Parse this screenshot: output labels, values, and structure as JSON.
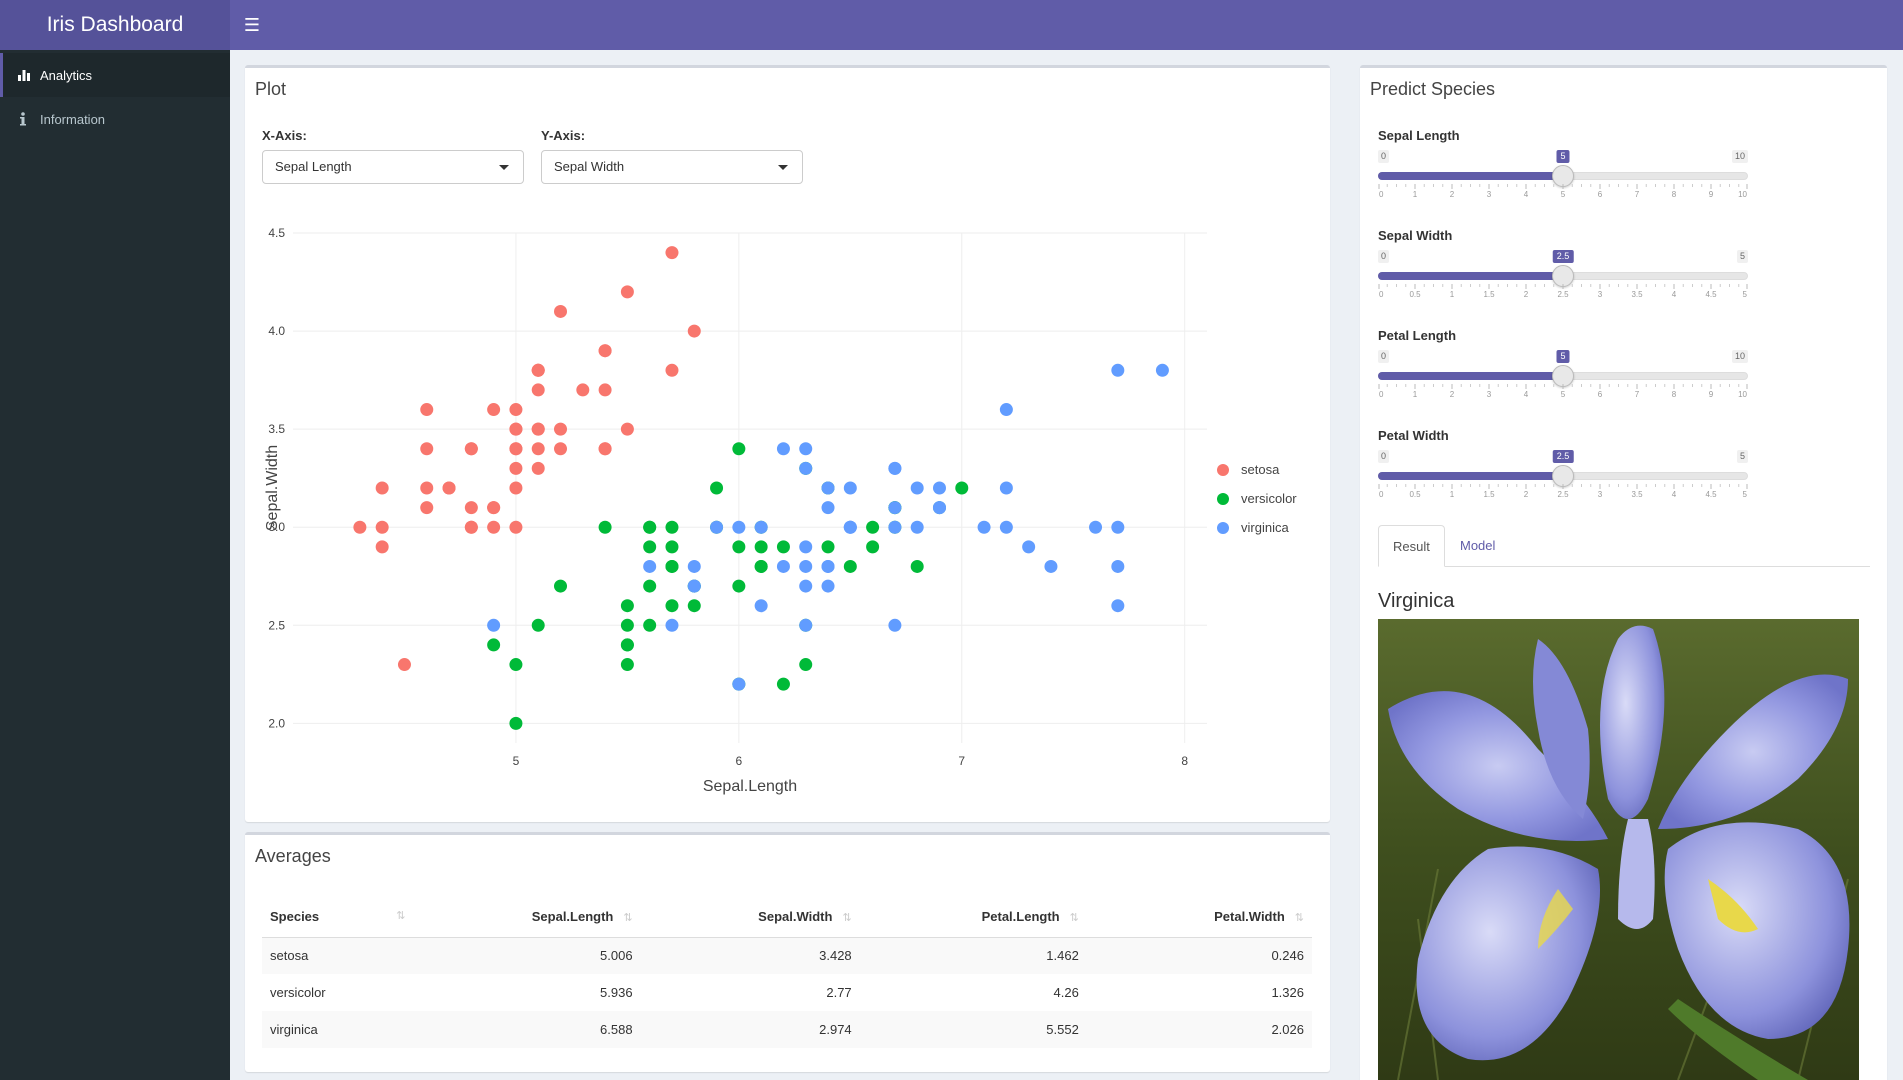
{
  "app": {
    "title": "Iris Dashboard"
  },
  "sidebar": {
    "items": [
      {
        "label": "Analytics",
        "icon": "bar-chart-icon"
      },
      {
        "label": "Information",
        "icon": "info-icon"
      }
    ]
  },
  "plot_box": {
    "title": "Plot",
    "x_axis": {
      "label": "X-Axis:",
      "value": "Sepal Length"
    },
    "y_axis": {
      "label": "Y-Axis:",
      "value": "Sepal Width"
    }
  },
  "chart_data": {
    "type": "scatter",
    "xlabel": "Sepal.Length",
    "ylabel": "Sepal.Width",
    "xlim": [
      4.0,
      8.1
    ],
    "ylim": [
      1.9,
      4.5
    ],
    "x_ticks": [
      "5",
      "6",
      "7",
      "8"
    ],
    "y_ticks": [
      "2.0",
      "2.5",
      "3.0",
      "3.5",
      "4.0",
      "4.5"
    ],
    "legend": "right",
    "series": [
      {
        "name": "setosa",
        "color": "#f8766d",
        "points": [
          [
            5.1,
            3.5
          ],
          [
            4.9,
            3.0
          ],
          [
            4.7,
            3.2
          ],
          [
            4.6,
            3.1
          ],
          [
            5.0,
            3.6
          ],
          [
            5.4,
            3.9
          ],
          [
            4.6,
            3.4
          ],
          [
            5.0,
            3.4
          ],
          [
            4.4,
            2.9
          ],
          [
            4.9,
            3.1
          ],
          [
            5.4,
            3.7
          ],
          [
            4.8,
            3.4
          ],
          [
            4.8,
            3.0
          ],
          [
            4.3,
            3.0
          ],
          [
            5.8,
            4.0
          ],
          [
            5.7,
            4.4
          ],
          [
            5.4,
            3.9
          ],
          [
            5.1,
            3.5
          ],
          [
            5.7,
            3.8
          ],
          [
            5.1,
            3.8
          ],
          [
            5.4,
            3.4
          ],
          [
            5.1,
            3.7
          ],
          [
            4.6,
            3.6
          ],
          [
            5.1,
            3.3
          ],
          [
            4.8,
            3.4
          ],
          [
            5.0,
            3.0
          ],
          [
            5.0,
            3.4
          ],
          [
            5.2,
            3.5
          ],
          [
            5.2,
            3.4
          ],
          [
            4.7,
            3.2
          ],
          [
            4.8,
            3.1
          ],
          [
            5.4,
            3.4
          ],
          [
            5.2,
            4.1
          ],
          [
            5.5,
            4.2
          ],
          [
            4.9,
            3.1
          ],
          [
            5.0,
            3.2
          ],
          [
            5.5,
            3.5
          ],
          [
            4.9,
            3.6
          ],
          [
            4.4,
            3.0
          ],
          [
            5.1,
            3.4
          ],
          [
            5.0,
            3.5
          ],
          [
            4.5,
            2.3
          ],
          [
            4.4,
            3.2
          ],
          [
            5.0,
            3.5
          ],
          [
            5.1,
            3.8
          ],
          [
            4.8,
            3.0
          ],
          [
            5.1,
            3.8
          ],
          [
            4.6,
            3.2
          ],
          [
            5.3,
            3.7
          ],
          [
            5.0,
            3.3
          ]
        ]
      },
      {
        "name": "versicolor",
        "color": "#00ba38",
        "points": [
          [
            7.0,
            3.2
          ],
          [
            6.4,
            3.2
          ],
          [
            6.9,
            3.1
          ],
          [
            5.5,
            2.3
          ],
          [
            6.5,
            2.8
          ],
          [
            5.7,
            2.8
          ],
          [
            6.3,
            3.3
          ],
          [
            4.9,
            2.4
          ],
          [
            6.6,
            2.9
          ],
          [
            5.2,
            2.7
          ],
          [
            5.0,
            2.0
          ],
          [
            5.9,
            3.0
          ],
          [
            6.0,
            2.2
          ],
          [
            6.1,
            2.9
          ],
          [
            5.6,
            2.9
          ],
          [
            6.7,
            3.1
          ],
          [
            5.6,
            3.0
          ],
          [
            5.8,
            2.7
          ],
          [
            6.2,
            2.2
          ],
          [
            5.6,
            2.5
          ],
          [
            5.9,
            3.2
          ],
          [
            6.1,
            2.8
          ],
          [
            6.3,
            2.5
          ],
          [
            6.1,
            2.8
          ],
          [
            6.4,
            2.9
          ],
          [
            6.6,
            3.0
          ],
          [
            6.8,
            2.8
          ],
          [
            6.7,
            3.0
          ],
          [
            6.0,
            2.9
          ],
          [
            5.7,
            2.6
          ],
          [
            5.5,
            2.4
          ],
          [
            5.5,
            2.4
          ],
          [
            5.8,
            2.7
          ],
          [
            6.0,
            2.7
          ],
          [
            5.4,
            3.0
          ],
          [
            6.0,
            3.4
          ],
          [
            6.7,
            3.1
          ],
          [
            6.3,
            2.3
          ],
          [
            5.6,
            3.0
          ],
          [
            5.5,
            2.5
          ],
          [
            5.5,
            2.6
          ],
          [
            6.1,
            3.0
          ],
          [
            5.8,
            2.6
          ],
          [
            5.0,
            2.3
          ],
          [
            5.6,
            2.7
          ],
          [
            5.7,
            3.0
          ],
          [
            5.7,
            2.9
          ],
          [
            6.2,
            2.9
          ],
          [
            5.1,
            2.5
          ],
          [
            5.7,
            2.8
          ]
        ]
      },
      {
        "name": "virginica",
        "color": "#619cff",
        "points": [
          [
            6.3,
            3.3
          ],
          [
            5.8,
            2.7
          ],
          [
            7.1,
            3.0
          ],
          [
            6.3,
            2.9
          ],
          [
            6.5,
            3.0
          ],
          [
            7.6,
            3.0
          ],
          [
            4.9,
            2.5
          ],
          [
            7.3,
            2.9
          ],
          [
            6.7,
            2.5
          ],
          [
            7.2,
            3.6
          ],
          [
            6.5,
            3.2
          ],
          [
            6.4,
            2.7
          ],
          [
            6.8,
            3.0
          ],
          [
            5.7,
            2.5
          ],
          [
            5.8,
            2.8
          ],
          [
            6.4,
            3.2
          ],
          [
            6.5,
            3.0
          ],
          [
            7.7,
            3.8
          ],
          [
            7.7,
            2.6
          ],
          [
            6.0,
            2.2
          ],
          [
            6.9,
            3.2
          ],
          [
            5.6,
            2.8
          ],
          [
            7.7,
            2.8
          ],
          [
            6.3,
            2.7
          ],
          [
            6.7,
            3.3
          ],
          [
            7.2,
            3.2
          ],
          [
            6.2,
            2.8
          ],
          [
            6.1,
            3.0
          ],
          [
            6.4,
            2.8
          ],
          [
            7.2,
            3.0
          ],
          [
            7.4,
            2.8
          ],
          [
            7.9,
            3.8
          ],
          [
            6.4,
            2.8
          ],
          [
            6.3,
            2.8
          ],
          [
            6.1,
            2.6
          ],
          [
            7.7,
            3.0
          ],
          [
            6.3,
            3.4
          ],
          [
            6.4,
            3.1
          ],
          [
            6.0,
            3.0
          ],
          [
            6.9,
            3.1
          ],
          [
            6.7,
            3.1
          ],
          [
            6.9,
            3.1
          ],
          [
            5.8,
            2.7
          ],
          [
            6.8,
            3.2
          ],
          [
            6.7,
            3.3
          ],
          [
            6.7,
            3.0
          ],
          [
            6.3,
            2.5
          ],
          [
            6.5,
            3.0
          ],
          [
            6.2,
            3.4
          ],
          [
            5.9,
            3.0
          ]
        ]
      }
    ]
  },
  "averages": {
    "title": "Averages",
    "columns": [
      "Species",
      "Sepal.Length",
      "Sepal.Width",
      "Petal.Length",
      "Petal.Width"
    ],
    "rows": [
      [
        "setosa",
        "5.006",
        "3.428",
        "1.462",
        "0.246"
      ],
      [
        "versicolor",
        "5.936",
        "2.77",
        "4.26",
        "1.326"
      ],
      [
        "virginica",
        "6.588",
        "2.974",
        "5.552",
        "2.026"
      ]
    ]
  },
  "predict": {
    "title": "Predict Species",
    "sliders": [
      {
        "label": "Sepal Length",
        "min": 0,
        "max": 10,
        "value": 5,
        "step": 1,
        "min_label": "0",
        "max_label": "10",
        "value_label": "5",
        "ticks": [
          "0",
          "1",
          "2",
          "3",
          "4",
          "5",
          "6",
          "7",
          "8",
          "9",
          "10"
        ]
      },
      {
        "label": "Sepal Width",
        "min": 0,
        "max": 5,
        "value": 2.5,
        "step": 0.5,
        "min_label": "0",
        "max_label": "5",
        "value_label": "2.5",
        "ticks": [
          "0",
          "0.5",
          "1",
          "1.5",
          "2",
          "2.5",
          "3",
          "3.5",
          "4",
          "4.5",
          "5"
        ]
      },
      {
        "label": "Petal Length",
        "min": 0,
        "max": 10,
        "value": 5,
        "step": 1,
        "min_label": "0",
        "max_label": "10",
        "value_label": "5",
        "ticks": [
          "0",
          "1",
          "2",
          "3",
          "4",
          "5",
          "6",
          "7",
          "8",
          "9",
          "10"
        ]
      },
      {
        "label": "Petal Width",
        "min": 0,
        "max": 5,
        "value": 2.5,
        "step": 0.5,
        "min_label": "0",
        "max_label": "5",
        "value_label": "2.5",
        "ticks": [
          "0",
          "0.5",
          "1",
          "1.5",
          "2",
          "2.5",
          "3",
          "3.5",
          "4",
          "4.5",
          "5"
        ]
      }
    ],
    "tabs": [
      "Result",
      "Model"
    ],
    "result": {
      "species": "Virginica"
    }
  },
  "colors": {
    "accent": "#605ca8",
    "sidebar": "#222d32"
  }
}
